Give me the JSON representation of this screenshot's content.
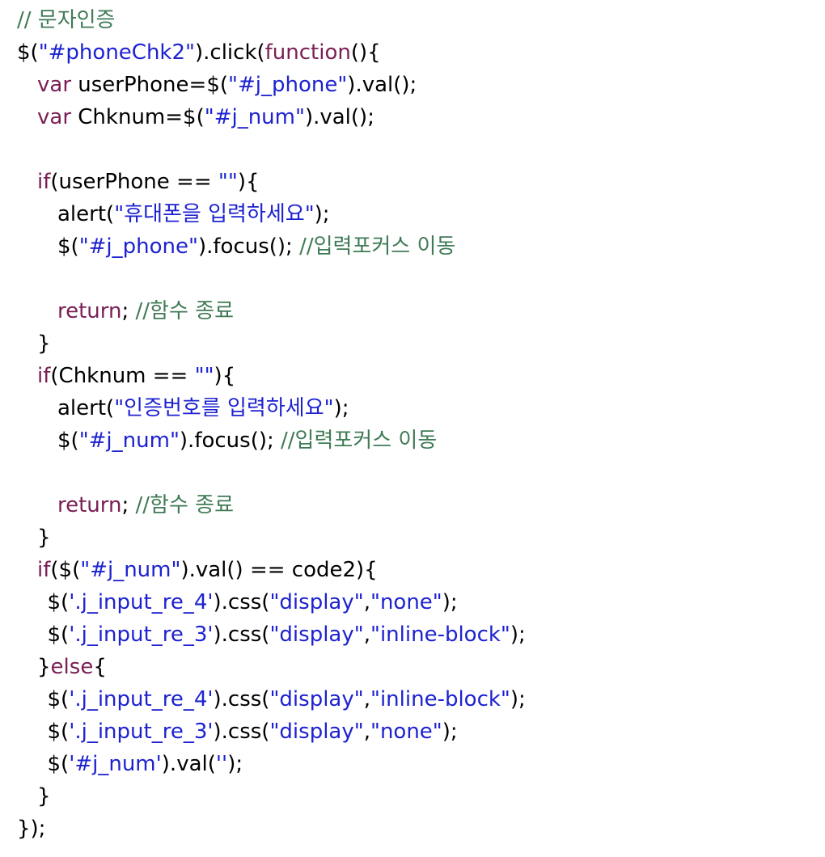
{
  "colors": {
    "background": "#ffffff",
    "plain": "#000000",
    "keyword": "#7a1f55",
    "string": "#1d22d0",
    "comment": "#3f7a55"
  },
  "lines": [
    {
      "indent": 0,
      "tokens": [
        {
          "t": "// 문자인증",
          "k": "comment"
        }
      ]
    },
    {
      "indent": 0,
      "tokens": [
        {
          "t": "$(",
          "k": "plain"
        },
        {
          "t": "\"#phoneChk2\"",
          "k": "string"
        },
        {
          "t": ").click(",
          "k": "plain"
        },
        {
          "t": "function",
          "k": "keyword"
        },
        {
          "t": "(){",
          "k": "plain"
        }
      ]
    },
    {
      "indent": 1,
      "tokens": [
        {
          "t": "var",
          "k": "keyword"
        },
        {
          "t": " userPhone=$(",
          "k": "plain"
        },
        {
          "t": "\"#j_phone\"",
          "k": "string"
        },
        {
          "t": ").val();",
          "k": "plain"
        }
      ]
    },
    {
      "indent": 1,
      "tokens": [
        {
          "t": "var",
          "k": "keyword"
        },
        {
          "t": " Chknum=$(",
          "k": "plain"
        },
        {
          "t": "\"#j_num\"",
          "k": "string"
        },
        {
          "t": ").val();",
          "k": "plain"
        }
      ]
    },
    {
      "indent": 0,
      "tokens": []
    },
    {
      "indent": 1,
      "tokens": [
        {
          "t": "if",
          "k": "keyword"
        },
        {
          "t": "(userPhone == ",
          "k": "plain"
        },
        {
          "t": "\"\"",
          "k": "string"
        },
        {
          "t": "){",
          "k": "plain"
        }
      ]
    },
    {
      "indent": 2,
      "tokens": [
        {
          "t": "alert(",
          "k": "plain"
        },
        {
          "t": "\"휴대폰을 입력하세요\"",
          "k": "string"
        },
        {
          "t": ");",
          "k": "plain"
        }
      ]
    },
    {
      "indent": 2,
      "tokens": [
        {
          "t": "$(",
          "k": "plain"
        },
        {
          "t": "\"#j_phone\"",
          "k": "string"
        },
        {
          "t": ").focus(); ",
          "k": "plain"
        },
        {
          "t": "//입력포커스 이동",
          "k": "comment"
        }
      ]
    },
    {
      "indent": 0,
      "tokens": []
    },
    {
      "indent": 2,
      "tokens": [
        {
          "t": "return",
          "k": "keyword"
        },
        {
          "t": "; ",
          "k": "plain"
        },
        {
          "t": "//함수 종료",
          "k": "comment"
        }
      ]
    },
    {
      "indent": 1,
      "tokens": [
        {
          "t": "}",
          "k": "plain"
        }
      ]
    },
    {
      "indent": 1,
      "tokens": [
        {
          "t": "if",
          "k": "keyword"
        },
        {
          "t": "(Chknum == ",
          "k": "plain"
        },
        {
          "t": "\"\"",
          "k": "string"
        },
        {
          "t": "){",
          "k": "plain"
        }
      ]
    },
    {
      "indent": 2,
      "tokens": [
        {
          "t": "alert(",
          "k": "plain"
        },
        {
          "t": "\"인증번호를 입력하세요\"",
          "k": "string"
        },
        {
          "t": ");",
          "k": "plain"
        }
      ]
    },
    {
      "indent": 2,
      "tokens": [
        {
          "t": "$(",
          "k": "plain"
        },
        {
          "t": "\"#j_num\"",
          "k": "string"
        },
        {
          "t": ").focus(); ",
          "k": "plain"
        },
        {
          "t": "//입력포커스 이동",
          "k": "comment"
        }
      ]
    },
    {
      "indent": 0,
      "tokens": []
    },
    {
      "indent": 2,
      "tokens": [
        {
          "t": "return",
          "k": "keyword"
        },
        {
          "t": "; ",
          "k": "plain"
        },
        {
          "t": "//함수 종료",
          "k": "comment"
        }
      ]
    },
    {
      "indent": 1,
      "tokens": [
        {
          "t": "}",
          "k": "plain"
        }
      ]
    },
    {
      "indent": 1,
      "tokens": [
        {
          "t": "if",
          "k": "keyword"
        },
        {
          "t": "($(",
          "k": "plain"
        },
        {
          "t": "\"#j_num\"",
          "k": "string"
        },
        {
          "t": ").val() == code2){",
          "k": "plain"
        }
      ]
    },
    {
      "indent": 1.5,
      "tokens": [
        {
          "t": "$(",
          "k": "plain"
        },
        {
          "t": "'.j_input_re_4'",
          "k": "string"
        },
        {
          "t": ").css(",
          "k": "plain"
        },
        {
          "t": "\"display\"",
          "k": "string"
        },
        {
          "t": ",",
          "k": "plain"
        },
        {
          "t": "\"none\"",
          "k": "string"
        },
        {
          "t": ");",
          "k": "plain"
        }
      ]
    },
    {
      "indent": 1.5,
      "tokens": [
        {
          "t": "$(",
          "k": "plain"
        },
        {
          "t": "'.j_input_re_3'",
          "k": "string"
        },
        {
          "t": ").css(",
          "k": "plain"
        },
        {
          "t": "\"display\"",
          "k": "string"
        },
        {
          "t": ",",
          "k": "plain"
        },
        {
          "t": "\"inline-block\"",
          "k": "string"
        },
        {
          "t": ");",
          "k": "plain"
        }
      ]
    },
    {
      "indent": 1,
      "tokens": [
        {
          "t": "}",
          "k": "plain"
        },
        {
          "t": "else",
          "k": "keyword"
        },
        {
          "t": "{",
          "k": "plain"
        }
      ]
    },
    {
      "indent": 1.5,
      "tokens": [
        {
          "t": "$(",
          "k": "plain"
        },
        {
          "t": "'.j_input_re_4'",
          "k": "string"
        },
        {
          "t": ").css(",
          "k": "plain"
        },
        {
          "t": "\"display\"",
          "k": "string"
        },
        {
          "t": ",",
          "k": "plain"
        },
        {
          "t": "\"inline-block\"",
          "k": "string"
        },
        {
          "t": ");",
          "k": "plain"
        }
      ]
    },
    {
      "indent": 1.5,
      "tokens": [
        {
          "t": "$(",
          "k": "plain"
        },
        {
          "t": "'.j_input_re_3'",
          "k": "string"
        },
        {
          "t": ").css(",
          "k": "plain"
        },
        {
          "t": "\"display\"",
          "k": "string"
        },
        {
          "t": ",",
          "k": "plain"
        },
        {
          "t": "\"none\"",
          "k": "string"
        },
        {
          "t": ");",
          "k": "plain"
        }
      ]
    },
    {
      "indent": 1.5,
      "tokens": [
        {
          "t": "$(",
          "k": "plain"
        },
        {
          "t": "'#j_num'",
          "k": "string"
        },
        {
          "t": ").val(",
          "k": "plain"
        },
        {
          "t": "''",
          "k": "string"
        },
        {
          "t": ");",
          "k": "plain"
        }
      ]
    },
    {
      "indent": 1,
      "tokens": [
        {
          "t": "}",
          "k": "plain"
        }
      ]
    },
    {
      "indent": 0,
      "tokens": [
        {
          "t": "});",
          "k": "plain"
        }
      ]
    }
  ]
}
